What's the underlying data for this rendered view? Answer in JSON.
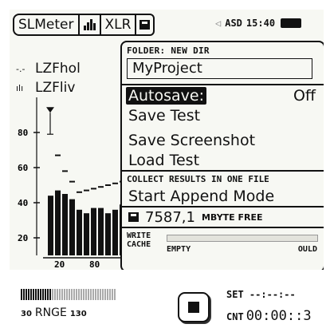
{
  "statusbar": {
    "tab_sound_meter": "SLMeter",
    "tab_input": "XLR",
    "device_name": "ASD",
    "time": "15:40",
    "icons": [
      "bars-icon",
      "disk-icon",
      "speaker-icon",
      "battery-icon"
    ]
  },
  "meter": {
    "legend_1": "LZFhol",
    "legend_2": "LZFliv",
    "legend_1_symbol": "-.-",
    "legend_2_symbol": "ılı"
  },
  "chart_data": {
    "type": "bar",
    "y_ticks": [
      "80",
      "60",
      "40",
      "20"
    ],
    "x_ticks": [
      "20",
      "80"
    ],
    "ylim": [
      10,
      100
    ],
    "bars": [
      44,
      47,
      45,
      42,
      36,
      34,
      37,
      37,
      34,
      36,
      39
    ],
    "hold_marks": [
      null,
      67,
      58,
      52,
      46,
      47,
      48,
      49,
      50,
      51,
      52
    ],
    "marker_level": 89
  },
  "menu": {
    "folder_header": "FOLDER: NEW DIR",
    "folder_name": "MyProject",
    "autosave_label": "Autosave:",
    "autosave_value": "Off",
    "save_test": "Save Test",
    "save_screenshot": "Save Screenshot",
    "load_test": "Load Test",
    "collect_header": "COLLECT RESULTS IN ONE FILE",
    "start_append": "Start Append Mode",
    "free_space_value": "7587,1",
    "free_space_unit": "MBYTE FREE",
    "write_cache_label_1": "WRITE",
    "write_cache_label_2": "CACHE",
    "write_cache_state": "EMPTY",
    "write_cache_right": "OULD",
    "write_cache_fill": 0
  },
  "bottom": {
    "range_low": "30",
    "range_label": "RNGE",
    "range_high": "130",
    "set_label": "SET",
    "set_value": "--:--:--",
    "count_label": "CNT",
    "count_value": "00:00::3"
  }
}
